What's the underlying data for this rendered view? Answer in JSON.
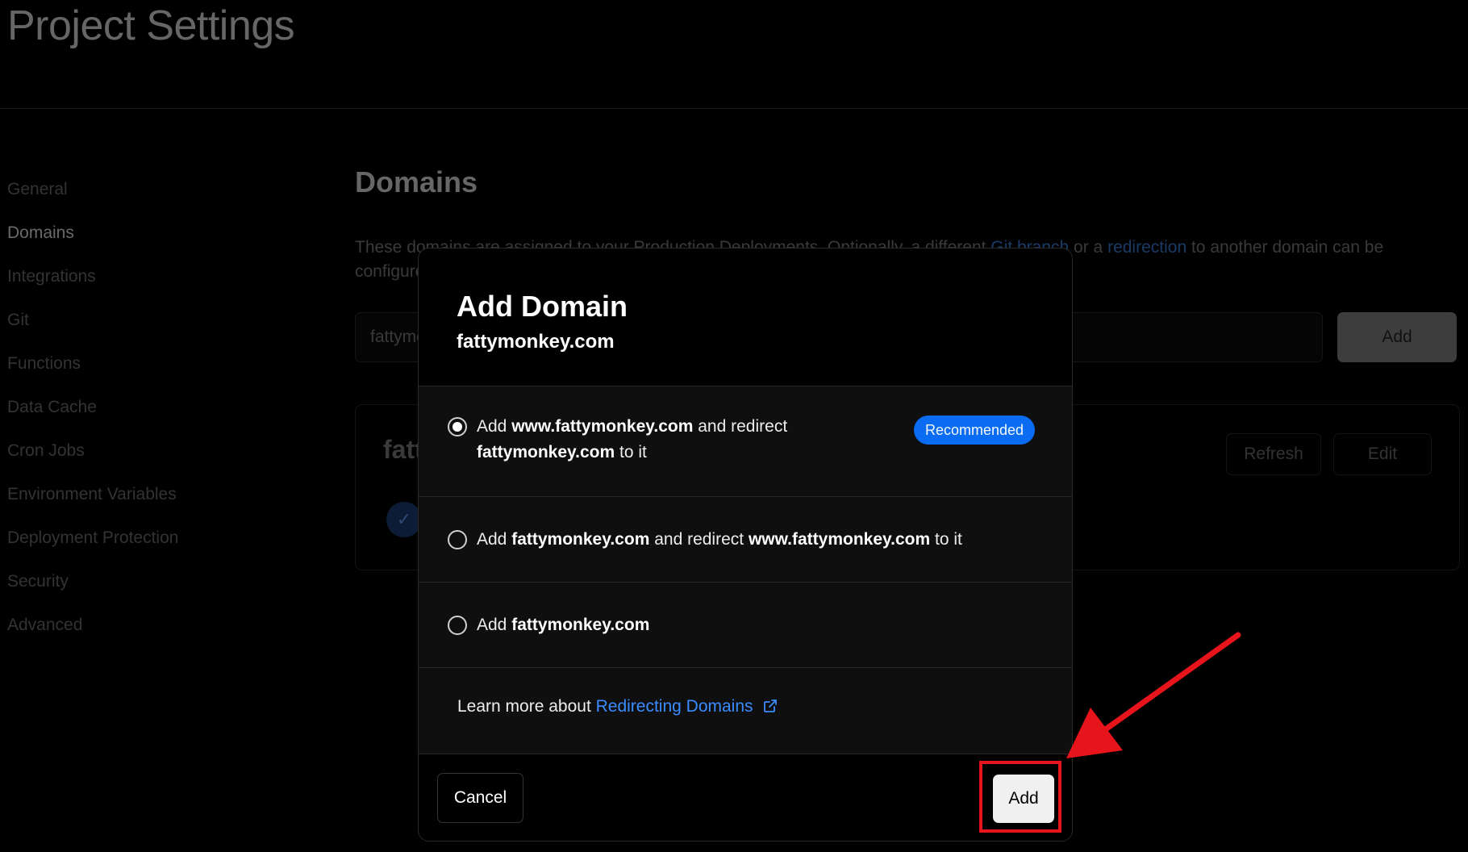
{
  "page": {
    "title": "Project Settings"
  },
  "sidebar": {
    "items": [
      {
        "label": "General"
      },
      {
        "label": "Domains"
      },
      {
        "label": "Integrations"
      },
      {
        "label": "Git"
      },
      {
        "label": "Functions"
      },
      {
        "label": "Data Cache"
      },
      {
        "label": "Cron Jobs"
      },
      {
        "label": "Environment Variables"
      },
      {
        "label": "Deployment Protection"
      },
      {
        "label": "Security"
      },
      {
        "label": "Advanced"
      }
    ],
    "active_index": 1
  },
  "domains_section": {
    "title": "Domains",
    "desc_1": "These domains are assigned to your Production Deployments. Optionally, a different ",
    "desc_link_1": "Git branch",
    "desc_2": " or a ",
    "desc_link_2": "redirection",
    "desc_3": " to another domain can be configured.",
    "input_value": "fattymonkey.com",
    "add_label": "Add",
    "card_domain": "fattymonkey.com",
    "refresh_label": "Refresh",
    "edit_label": "Edit"
  },
  "modal": {
    "title": "Add Domain",
    "subtitle": "fattymonkey.com",
    "options": [
      {
        "checked": true,
        "p1": "Add ",
        "b1": "www.fattymonkey.com",
        "p2": " and redirect ",
        "b2": "fattymonkey.com",
        "p3": " to it",
        "badge": "Recommended"
      },
      {
        "checked": false,
        "p1": "Add ",
        "b1": "fattymonkey.com",
        "p2": " and redirect ",
        "b2": "www.fattymonkey.com",
        "p3": " to it"
      },
      {
        "checked": false,
        "p1": "Add ",
        "b1": "fattymonkey.com"
      }
    ],
    "learn_prefix": "Learn more about ",
    "learn_link": "Redirecting Domains",
    "cancel_label": "Cancel",
    "add_label": "Add"
  },
  "colors": {
    "accent_blue": "#0a6cf2",
    "link_blue": "#3b8cff",
    "annotation_red": "#e8141b"
  },
  "icons": [
    "check-icon",
    "radio-selected-icon",
    "radio-empty-icon",
    "external-link-icon",
    "annotation-arrow-icon"
  ]
}
